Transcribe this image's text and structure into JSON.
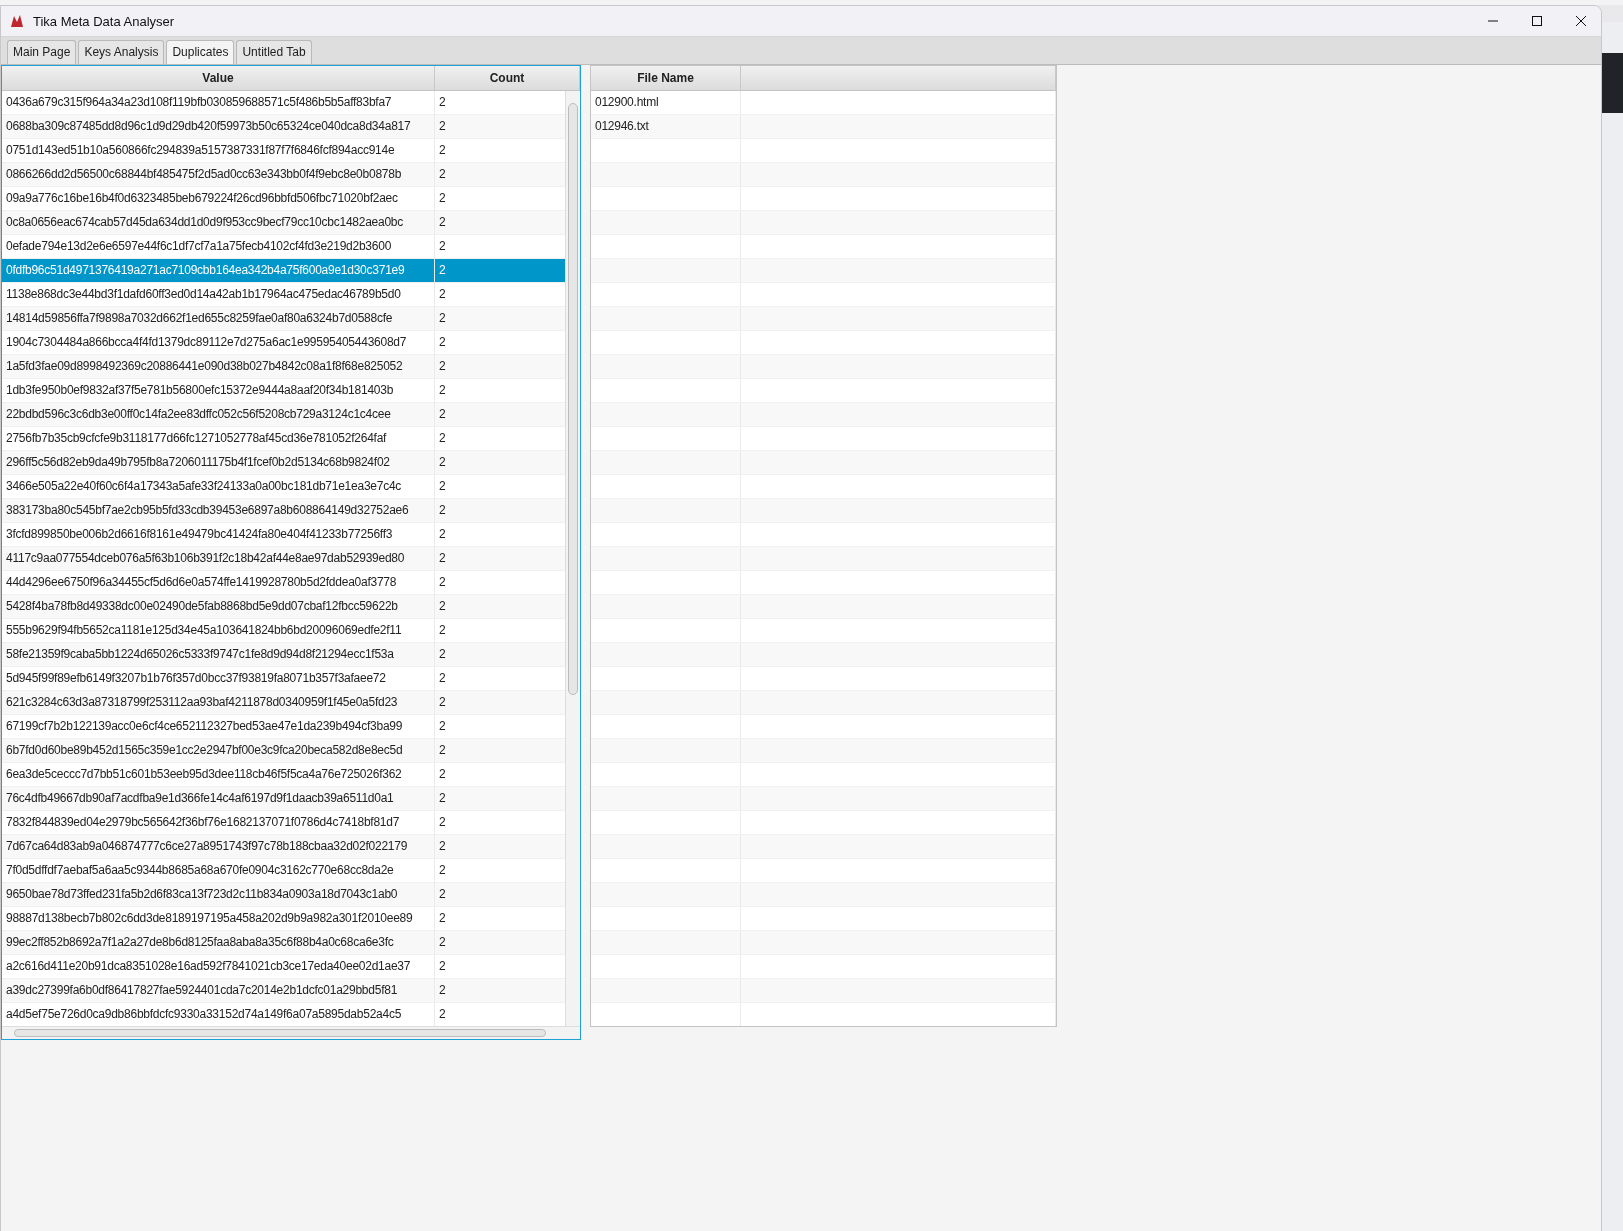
{
  "window": {
    "title": "Tika Meta Data Analyser"
  },
  "tabs": [
    {
      "label": "Main Page",
      "selected": false
    },
    {
      "label": "Keys Analysis",
      "selected": false
    },
    {
      "label": "Duplicates",
      "selected": true
    },
    {
      "label": "Untitled Tab",
      "selected": false
    }
  ],
  "value_table": {
    "columns": [
      "Value",
      "Count"
    ],
    "rows": [
      {
        "value": "0436a679c315f964a34a23d108f119bfb030859688571c5f486b5b5aff83bfa7",
        "count": "2",
        "selected": false
      },
      {
        "value": "0688ba309c87485dd8d96c1d9d29db420f59973b50c65324ce040dca8d34a817",
        "count": "2",
        "selected": false
      },
      {
        "value": "0751d143ed51b10a560866fc294839a5157387331f87f7f6846fcf894acc914e",
        "count": "2",
        "selected": false
      },
      {
        "value": "0866266dd2d56500c68844bf485475f2d5ad0cc63e343bb0f4f9ebc8e0b0878b",
        "count": "2",
        "selected": false
      },
      {
        "value": "09a9a776c16be16b4f0d6323485beb679224f26cd96bbfd506fbc71020bf2aec",
        "count": "2",
        "selected": false
      },
      {
        "value": "0c8a0656eac674cab57d45da634dd1d0d9f953cc9becf79cc10cbc1482aea0bc",
        "count": "2",
        "selected": false
      },
      {
        "value": "0efade794e13d2e6e6597e44f6c1df7cf7a1a75fecb4102cf4fd3e219d2b3600",
        "count": "2",
        "selected": false
      },
      {
        "value": "0fdfb96c51d4971376419a271ac7109cbb164ea342b4a75f600a9e1d30c371e9",
        "count": "2",
        "selected": true
      },
      {
        "value": "1138e868dc3e44bd3f1dafd60ff3ed0d14a42ab1b17964ac475edac46789b5d0",
        "count": "2",
        "selected": false
      },
      {
        "value": "14814d59856ffa7f9898a7032d662f1ed655c8259fae0af80a6324b7d0588cfe",
        "count": "2",
        "selected": false
      },
      {
        "value": "1904c7304484a866bcca4f4fd1379dc89112e7d275a6ac1e99595405443608d7",
        "count": "2",
        "selected": false
      },
      {
        "value": "1a5fd3fae09d8998492369c20886441e090d38b027b4842c08a1f8f68e825052",
        "count": "2",
        "selected": false
      },
      {
        "value": "1db3fe950b0ef9832af37f5e781b56800efc15372e9444a8aaf20f34b181403b",
        "count": "2",
        "selected": false
      },
      {
        "value": "22bdbd596c3c6db3e00ff0c14fa2ee83dffc052c56f5208cb729a3124c1c4cee",
        "count": "2",
        "selected": false
      },
      {
        "value": "2756fb7b35cb9cfcfe9b3118177d66fc1271052778af45cd36e781052f264faf",
        "count": "2",
        "selected": false
      },
      {
        "value": "296ff5c56d82eb9da49b795fb8a7206011175b4f1fcef0b2d5134c68b9824f02",
        "count": "2",
        "selected": false
      },
      {
        "value": "3466e505a22e40f60c6f4a17343a5afe33f24133a0a00bc181db71e1ea3e7c4c",
        "count": "2",
        "selected": false
      },
      {
        "value": "383173ba80c545bf7ae2cb95b5fd33cdb39453e6897a8b608864149d32752ae6",
        "count": "2",
        "selected": false
      },
      {
        "value": "3fcfd899850be006b2d6616f8161e49479bc41424fa80e404f41233b77256ff3",
        "count": "2",
        "selected": false
      },
      {
        "value": "4117c9aa077554dceb076a5f63b106b391f2c18b42af44e8ae97dab52939ed80",
        "count": "2",
        "selected": false
      },
      {
        "value": "44d4296ee6750f96a34455cf5d6d6e0a574ffe1419928780b5d2fddea0af3778",
        "count": "2",
        "selected": false
      },
      {
        "value": "5428f4ba78fb8d49338dc00e02490de5fab8868bd5e9dd07cbaf12fbcc59622b",
        "count": "2",
        "selected": false
      },
      {
        "value": "555b9629f94fb5652ca1181e125d34e45a103641824bb6bd20096069edfe2f11",
        "count": "2",
        "selected": false
      },
      {
        "value": "58fe21359f9caba5bb1224d65026c5333f9747c1fe8d9d94d8f21294ecc1f53a",
        "count": "2",
        "selected": false
      },
      {
        "value": "5d945f99f89efb6149f3207b1b76f357d0bcc37f93819fa8071b357f3afaee72",
        "count": "2",
        "selected": false
      },
      {
        "value": "621c3284c63d3a87318799f253112aa93baf4211878d0340959f1f45e0a5fd23",
        "count": "2",
        "selected": false
      },
      {
        "value": "67199cf7b2b122139acc0e6cf4ce652112327bed53ae47e1da239b494cf3ba99",
        "count": "2",
        "selected": false
      },
      {
        "value": "6b7fd0d60be89b452d1565c359e1cc2e2947bf00e3c9fca20beca582d8e8ec5d",
        "count": "2",
        "selected": false
      },
      {
        "value": "6ea3de5ceccc7d7bb51c601b53eeb95d3dee118cb46f5f5ca4a76e725026f362",
        "count": "2",
        "selected": false
      },
      {
        "value": "76c4dfb49667db90af7acdfba9e1d366fe14c4af6197d9f1daacb39a6511d0a1",
        "count": "2",
        "selected": false
      },
      {
        "value": "7832f844839ed04e2979bc565642f36bf76e1682137071f0786d4c7418bf81d7",
        "count": "2",
        "selected": false
      },
      {
        "value": "7d67ca64d83ab9a046874777c6ce27a8951743f97c78b188cbaa32d02f022179",
        "count": "2",
        "selected": false
      },
      {
        "value": "7f0d5dffdf7aebaf5a6aa5c9344b8685a68a670fe0904c3162c770e68cc8da2e",
        "count": "2",
        "selected": false
      },
      {
        "value": "9650bae78d73ffed231fa5b2d6f83ca13f723d2c11b834a0903a18d7043c1ab0",
        "count": "2",
        "selected": false
      },
      {
        "value": "98887d138becb7b802c6dd3de8189197195a458a202d9b9a982a301f2010ee89",
        "count": "2",
        "selected": false
      },
      {
        "value": "99ec2ff852b8692a7f1a2a27de8b6d8125faa8aba8a35c6f88b4a0c68ca6e3fc",
        "count": "2",
        "selected": false
      },
      {
        "value": "a2c616d411e20b91dca8351028e16ad592f7841021cb3ce17eda40ee02d1ae37",
        "count": "2",
        "selected": false
      },
      {
        "value": "a39dc27399fa6b0df86417827fae5924401cda7c2014e2b1dcfc01a29bbd5f81",
        "count": "2",
        "selected": false
      },
      {
        "value": "a4d5ef75e726d0ca9db86bbfdcfc9330a33152d74a149f6a07a5895dab52a4c5",
        "count": "2",
        "selected": false
      }
    ]
  },
  "files_table": {
    "columns": [
      "File Name"
    ],
    "rows": [
      {
        "file_name": "012900.html"
      },
      {
        "file_name": "012946.txt"
      }
    ]
  }
}
